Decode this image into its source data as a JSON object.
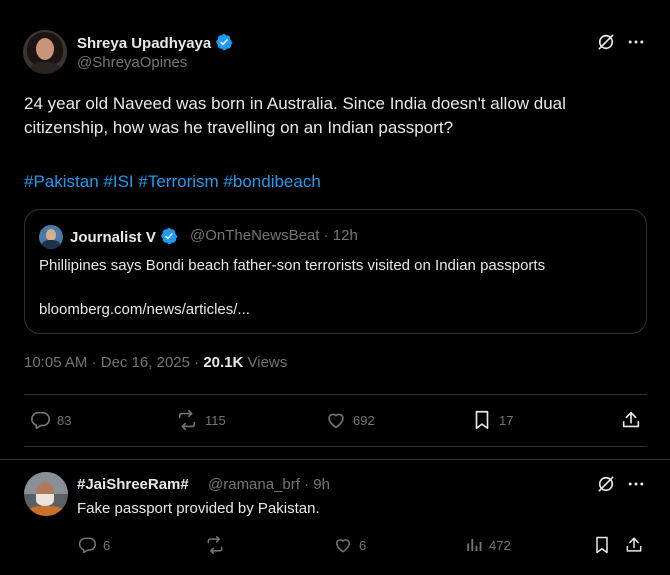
{
  "post": {
    "author_name": "Shreya Upadhyaya",
    "author_handle": "@ShreyaOpines",
    "text": "24 year old Naveed was born in Australia. Since India doesn't allow dual citizenship, how was he travelling on an Indian passport?",
    "hashtags": [
      "#Pakistan",
      "#ISI",
      "#Terrorism",
      "#bondibeach"
    ],
    "time": "10:05 AM",
    "date": "Dec 16, 2025",
    "views_count": "20.1K",
    "views_label": "Views",
    "stats": {
      "replies": "83",
      "reposts": "115",
      "likes": "692",
      "bookmarks": "17"
    }
  },
  "quote": {
    "author_name": "Journalist V",
    "author_handle": "@OnTheNewsBeat",
    "age": "12h",
    "text": "Phillipines says Bondi beach father-son terrorists visited on Indian passports",
    "link": "bloomberg.com/news/articles/..."
  },
  "reply": {
    "author_name": "#JaiShreeRam#",
    "author_handle": "@ramana_brf",
    "age": "9h",
    "text": "Fake passport provided by Pakistan.",
    "stats": {
      "replies": "6",
      "reposts": "",
      "likes": "6",
      "views": "472"
    }
  },
  "colors": {
    "background": "#000000",
    "text_primary": "#e7e9ea",
    "text_secondary": "#71767b",
    "accent": "#1d9bf0",
    "border": "#2f3336"
  },
  "icons": [
    "verified-badge-icon",
    "grok-icon",
    "more-icon",
    "reply-icon",
    "repost-icon",
    "like-icon",
    "bookmark-icon",
    "share-icon",
    "views-icon"
  ]
}
